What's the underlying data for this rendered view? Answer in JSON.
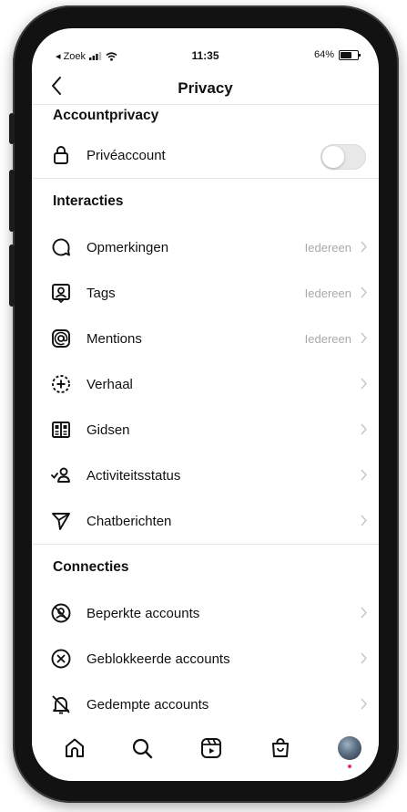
{
  "status_bar": {
    "back_app": "◂ Zoek",
    "time": "11:35",
    "battery": "64%",
    "battery_level": 0.64
  },
  "nav": {
    "back_glyph": "‹",
    "title": "Privacy"
  },
  "sections": {
    "account_privacy": {
      "header": "Accountprivacy",
      "private_account": {
        "label": "Privéaccount",
        "icon": "lock-icon",
        "toggle_on": false
      }
    },
    "interactions": {
      "header": "Interacties",
      "items": [
        {
          "label": "Opmerkingen",
          "value": "Iedereen",
          "icon": "comment-icon"
        },
        {
          "label": "Tags",
          "value": "Iedereen",
          "icon": "tag-person-icon"
        },
        {
          "label": "Mentions",
          "value": "Iedereen",
          "icon": "at-icon"
        },
        {
          "label": "Verhaal",
          "value": "",
          "icon": "story-add-icon"
        },
        {
          "label": "Gidsen",
          "value": "",
          "icon": "guides-icon"
        },
        {
          "label": "Activiteitsstatus",
          "value": "",
          "icon": "activity-status-icon"
        },
        {
          "label": "Chatberichten",
          "value": "",
          "icon": "paper-plane-icon"
        }
      ]
    },
    "connections": {
      "header": "Connecties",
      "items": [
        {
          "label": "Beperkte accounts",
          "icon": "restricted-icon"
        },
        {
          "label": "Geblokkeerde accounts",
          "icon": "blocked-icon"
        },
        {
          "label": "Gedempte accounts",
          "icon": "muted-bell-icon"
        }
      ]
    }
  },
  "tabbar": {
    "items": [
      "home-icon",
      "search-icon",
      "reels-icon",
      "shop-icon",
      "profile-avatar"
    ]
  },
  "colors": {
    "text": "#111111",
    "secondary": "#a9a9a9",
    "divider": "#e6e6e6",
    "notification_dot": "#e1306c"
  }
}
